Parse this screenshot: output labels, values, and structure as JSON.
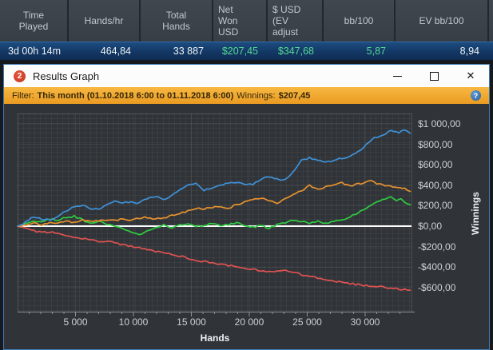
{
  "stats_table": {
    "columns": [
      {
        "label": "Time\nPlayed",
        "value": "3d 00h 14m",
        "value_color": "white"
      },
      {
        "label": "Hands/hr",
        "value": "464,84",
        "value_color": "white"
      },
      {
        "label": "Total\nHands",
        "value": "33 887",
        "value_color": "white"
      },
      {
        "label": "Net\nWon\nUSD",
        "value": "$207,45",
        "value_color": "green"
      },
      {
        "label": "$ USD\n(EV\nadjust",
        "value": "$347,68",
        "value_color": "green"
      },
      {
        "label": "bb/100",
        "value": "5,87",
        "value_color": "green"
      },
      {
        "label": "EV bb/100",
        "value": "8,94",
        "value_color": "white"
      }
    ]
  },
  "window": {
    "title": "Results Graph",
    "icon_badge": "2",
    "close_glyph": "✕",
    "controls": [
      "minimize",
      "maximize",
      "close"
    ]
  },
  "filter_bar": {
    "label": "Filter:",
    "range": "This month (01.10.2018 6:00 to 01.11.2018 6:00)",
    "winnings_label": "Winnings:",
    "winnings_value": "$207,45",
    "help_glyph": "?"
  },
  "colors": {
    "green_text": "#55db92",
    "filter_orange": "#f0a632",
    "row_bg": "#143663",
    "chart_bg": "#303438"
  },
  "chart_data": {
    "type": "line",
    "xlabel": "Hands",
    "ylabel": "Winnings",
    "xlim": [
      0,
      34000
    ],
    "ylim": [
      -840,
      1080
    ],
    "grid": true,
    "legend": "none",
    "zero_line_color": "#ffffff",
    "x_ticks": [
      {
        "v": 5000,
        "label": "5 000"
      },
      {
        "v": 10000,
        "label": "10 000"
      },
      {
        "v": 15000,
        "label": "15 000"
      },
      {
        "v": 20000,
        "label": "20 000"
      },
      {
        "v": 25000,
        "label": "25 000"
      },
      {
        "v": 30000,
        "label": "30 000"
      }
    ],
    "y_ticks": [
      {
        "v": 1000,
        "label": "$1 000,00"
      },
      {
        "v": 800,
        "label": "$800,00"
      },
      {
        "v": 600,
        "label": "$600,00"
      },
      {
        "v": 400,
        "label": "$400,00"
      },
      {
        "v": 200,
        "label": "$200,00"
      },
      {
        "v": 0,
        "label": "$0,00"
      },
      {
        "v": -200,
        "label": "-$200,00"
      },
      {
        "v": -400,
        "label": "-$400,00"
      },
      {
        "v": -600,
        "label": "-$600,00"
      }
    ],
    "series": [
      {
        "name": "red",
        "color": "#e05252",
        "points": [
          [
            0,
            0
          ],
          [
            700,
            -20
          ],
          [
            1400,
            -46
          ],
          [
            2100,
            -62
          ],
          [
            2800,
            -56
          ],
          [
            3500,
            -76
          ],
          [
            4200,
            -92
          ],
          [
            4900,
            -106
          ],
          [
            5600,
            -122
          ],
          [
            6300,
            -136
          ],
          [
            7000,
            -150
          ],
          [
            7700,
            -146
          ],
          [
            8400,
            -166
          ],
          [
            9100,
            -182
          ],
          [
            9800,
            -196
          ],
          [
            10500,
            -212
          ],
          [
            11200,
            -226
          ],
          [
            11900,
            -246
          ],
          [
            12600,
            -262
          ],
          [
            13300,
            -276
          ],
          [
            14000,
            -292
          ],
          [
            14700,
            -312
          ],
          [
            15400,
            -332
          ],
          [
            16100,
            -346
          ],
          [
            16800,
            -356
          ],
          [
            17500,
            -372
          ],
          [
            18200,
            -386
          ],
          [
            18900,
            -396
          ],
          [
            19600,
            -412
          ],
          [
            20300,
            -422
          ],
          [
            21000,
            -432
          ],
          [
            21700,
            -442
          ],
          [
            22400,
            -446
          ],
          [
            23100,
            -436
          ],
          [
            23800,
            -452
          ],
          [
            24500,
            -472
          ],
          [
            25200,
            -492
          ],
          [
            25900,
            -506
          ],
          [
            26600,
            -522
          ],
          [
            27300,
            -536
          ],
          [
            28000,
            -546
          ],
          [
            28700,
            -562
          ],
          [
            29400,
            -572
          ],
          [
            30100,
            -582
          ],
          [
            30800,
            -586
          ],
          [
            31500,
            -596
          ],
          [
            32200,
            -606
          ],
          [
            32900,
            -616
          ],
          [
            33400,
            -620
          ],
          [
            33887,
            -626
          ]
        ]
      },
      {
        "name": "green",
        "color": "#2ecc40",
        "points": [
          [
            0,
            0
          ],
          [
            700,
            30
          ],
          [
            1400,
            56
          ],
          [
            2100,
            36
          ],
          [
            2800,
            70
          ],
          [
            3500,
            60
          ],
          [
            4200,
            86
          ],
          [
            4900,
            96
          ],
          [
            5600,
            62
          ],
          [
            6300,
            26
          ],
          [
            7000,
            46
          ],
          [
            7700,
            20
          ],
          [
            8400,
            0
          ],
          [
            9100,
            -22
          ],
          [
            9800,
            -62
          ],
          [
            10500,
            -82
          ],
          [
            11200,
            -46
          ],
          [
            11900,
            -12
          ],
          [
            12600,
            10
          ],
          [
            13300,
            -16
          ],
          [
            14000,
            6
          ],
          [
            14700,
            22
          ],
          [
            15400,
            -6
          ],
          [
            16100,
            10
          ],
          [
            16800,
            26
          ],
          [
            17500,
            6
          ],
          [
            18200,
            16
          ],
          [
            18900,
            32
          ],
          [
            19600,
            10
          ],
          [
            20300,
            -12
          ],
          [
            21000,
            6
          ],
          [
            21700,
            -22
          ],
          [
            22400,
            16
          ],
          [
            23100,
            36
          ],
          [
            23800,
            62
          ],
          [
            24500,
            46
          ],
          [
            25200,
            30
          ],
          [
            25900,
            52
          ],
          [
            26600,
            26
          ],
          [
            27300,
            42
          ],
          [
            28000,
            62
          ],
          [
            28700,
            92
          ],
          [
            29400,
            132
          ],
          [
            30100,
            176
          ],
          [
            30800,
            232
          ],
          [
            31500,
            262
          ],
          [
            32200,
            292
          ],
          [
            32700,
            256
          ],
          [
            33100,
            272
          ],
          [
            33400,
            242
          ],
          [
            33887,
            210
          ]
        ]
      },
      {
        "name": "orange",
        "color": "#e8922e",
        "points": [
          [
            0,
            0
          ],
          [
            700,
            12
          ],
          [
            1400,
            26
          ],
          [
            2100,
            14
          ],
          [
            2800,
            40
          ],
          [
            3500,
            28
          ],
          [
            4200,
            46
          ],
          [
            4900,
            38
          ],
          [
            5600,
            56
          ],
          [
            6300,
            44
          ],
          [
            7000,
            52
          ],
          [
            7700,
            62
          ],
          [
            8400,
            54
          ],
          [
            9100,
            72
          ],
          [
            9800,
            60
          ],
          [
            10500,
            76
          ],
          [
            11200,
            86
          ],
          [
            11900,
            70
          ],
          [
            12600,
            82
          ],
          [
            13300,
            102
          ],
          [
            14000,
            122
          ],
          [
            14700,
            152
          ],
          [
            15400,
            176
          ],
          [
            16100,
            164
          ],
          [
            16800,
            186
          ],
          [
            17500,
            196
          ],
          [
            18200,
            172
          ],
          [
            18900,
            212
          ],
          [
            19600,
            236
          ],
          [
            20300,
            256
          ],
          [
            21000,
            276
          ],
          [
            21700,
            250
          ],
          [
            22400,
            216
          ],
          [
            23100,
            272
          ],
          [
            23800,
            312
          ],
          [
            24500,
            346
          ],
          [
            25200,
            396
          ],
          [
            25900,
            366
          ],
          [
            26600,
            382
          ],
          [
            27300,
            398
          ],
          [
            28000,
            422
          ],
          [
            28700,
            392
          ],
          [
            29400,
            412
          ],
          [
            30100,
            432
          ],
          [
            30500,
            442
          ],
          [
            31000,
            416
          ],
          [
            31700,
            396
          ],
          [
            32400,
            382
          ],
          [
            33000,
            370
          ],
          [
            33400,
            364
          ],
          [
            33887,
            348
          ]
        ]
      },
      {
        "name": "blue",
        "color": "#3f91d8",
        "points": [
          [
            0,
            0
          ],
          [
            700,
            40
          ],
          [
            1400,
            95
          ],
          [
            2100,
            70
          ],
          [
            2800,
            60
          ],
          [
            3500,
            95
          ],
          [
            4200,
            150
          ],
          [
            4900,
            185
          ],
          [
            5600,
            205
          ],
          [
            6300,
            175
          ],
          [
            7000,
            162
          ],
          [
            7700,
            210
          ],
          [
            8400,
            242
          ],
          [
            9100,
            228
          ],
          [
            9800,
            238
          ],
          [
            10500,
            225
          ],
          [
            11200,
            272
          ],
          [
            11900,
            292
          ],
          [
            12600,
            258
          ],
          [
            13300,
            300
          ],
          [
            14000,
            355
          ],
          [
            14700,
            400
          ],
          [
            15400,
            412
          ],
          [
            16100,
            348
          ],
          [
            16800,
            378
          ],
          [
            17500,
            398
          ],
          [
            18200,
            422
          ],
          [
            18900,
            432
          ],
          [
            19600,
            415
          ],
          [
            20300,
            405
          ],
          [
            21000,
            458
          ],
          [
            21700,
            482
          ],
          [
            22400,
            462
          ],
          [
            23100,
            452
          ],
          [
            23800,
            530
          ],
          [
            24500,
            640
          ],
          [
            25200,
            668
          ],
          [
            25900,
            642
          ],
          [
            26600,
            625
          ],
          [
            27300,
            642
          ],
          [
            28000,
            662
          ],
          [
            28700,
            682
          ],
          [
            29400,
            728
          ],
          [
            30100,
            800
          ],
          [
            30800,
            862
          ],
          [
            31500,
            892
          ],
          [
            32200,
            932
          ],
          [
            32900,
            918
          ],
          [
            33400,
            938
          ],
          [
            33887,
            905
          ]
        ]
      }
    ]
  }
}
